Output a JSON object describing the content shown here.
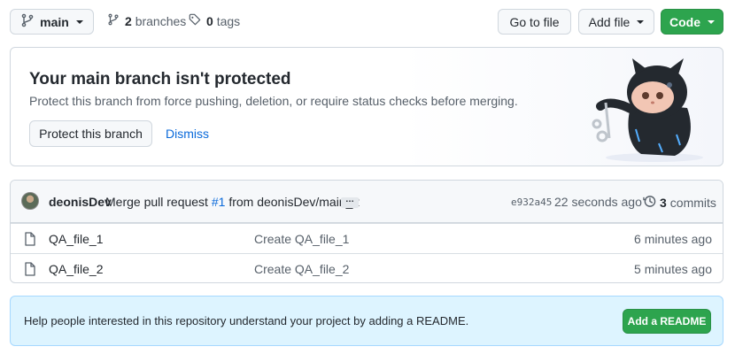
{
  "toolbar": {
    "branch_name": "main",
    "branches_count": "2",
    "branches_label": "branches",
    "tags_count": "0",
    "tags_label": "tags",
    "go_to_file_label": "Go to file",
    "add_file_label": "Add file",
    "code_label": "Code"
  },
  "protect_banner": {
    "title": "Your main branch isn't protected",
    "description": "Protect this branch from force pushing, deletion, or require status checks before merging.",
    "protect_button_label": "Protect this branch",
    "dismiss_label": "Dismiss"
  },
  "latest_commit": {
    "author": "deonisDev",
    "message_prefix": "Merge pull request",
    "pr_link": "#1",
    "message_suffix": "from deonisDev/main_2",
    "ellipsis": "…",
    "sha": "e932a45",
    "time": "22 seconds ago",
    "commits_count": "3",
    "commits_label": "commits"
  },
  "files": [
    {
      "name": "QA_file_1",
      "message": "Create QA_file_1",
      "age": "6 minutes ago"
    },
    {
      "name": "QA_file_2",
      "message": "Create QA_file_2",
      "age": "5 minutes ago"
    }
  ],
  "readme_banner": {
    "text": "Help people interested in this repository understand your project by adding a README.",
    "button_label": "Add a README"
  },
  "colors": {
    "accent_green": "#2da44e",
    "link_blue": "#0969da",
    "banner_blue": "#ddf4ff"
  },
  "icons": [
    "branch-icon",
    "tag-icon",
    "file-icon",
    "history-icon",
    "octocat-illustration"
  ]
}
